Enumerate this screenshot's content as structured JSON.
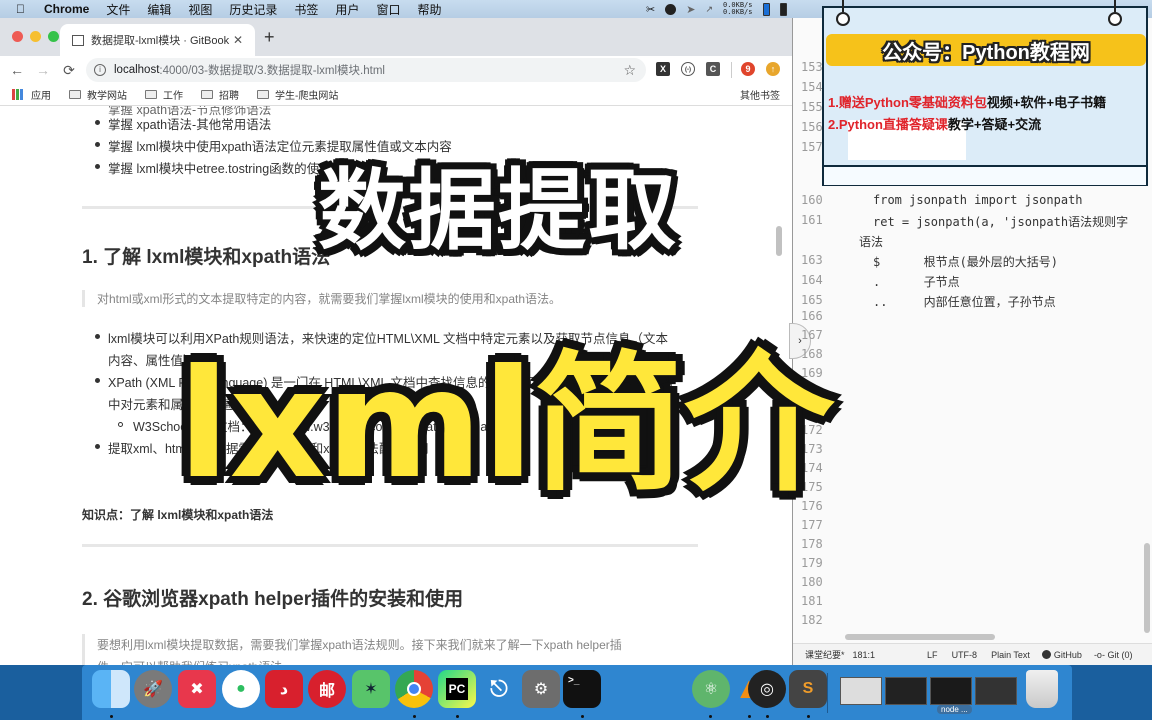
{
  "menubar": {
    "app_name": "Chrome",
    "items": [
      "文件",
      "编辑",
      "视图",
      "历史记录",
      "书签",
      "用户",
      "窗口",
      "帮助"
    ],
    "net_up": "0.0KB/s",
    "net_down": "0.0KB/s"
  },
  "browser": {
    "tab_title": "数据提取-lxml模块 · GitBook",
    "url_host": "localhost",
    "url_path": ":4000/03-数据提取/3.数据提取-lxml模块.html",
    "extensions": [
      "X",
      "(-)",
      "C",
      "9",
      "↑"
    ],
    "bookmarks": [
      "应用",
      "教学网站",
      "工作",
      "招聘",
      "学生-爬虫网站"
    ],
    "other_bookmarks": "其他书签"
  },
  "page": {
    "top_partial": "掌握 xpath语法-节点修饰语法",
    "goals": [
      "掌握 xpath语法-其他常用语法",
      "掌握 lxml模块中使用xpath语法定位元素提取属性值或文本内容",
      "掌握 lxml模块中etree.tostring函数的使用"
    ],
    "section1": {
      "heading": "1. 了解 lxml模块和xpath语法",
      "quote": "对html或xml形式的文本提取特定的内容，就需要我们掌握lxml模块的使用和xpath语法。",
      "bullets": [
        "lxml模块可以利用XPath规则语法，来快速的定位HTML\\XML 文档中特定元素以及获取节点信息（文本",
        "内容、属性值）",
        "XPath (XML Path Language) 是一门在 HTML\\XML 文档中查找信息的语言，可用来在 HTML\\XML 文档",
        "中对元素和属性进行遍历。",
        "提取xml、html中的数据需要lxml模块和xpath语法配合使用"
      ],
      "sub_bullet": "W3School官方文档：http://www.w3school.com.cn/xpath/index.asp",
      "knowledge": "知识点：了解 lxml模块和xpath语法"
    },
    "section2": {
      "heading": "2. 谷歌浏览器xpath helper插件的安装和使用",
      "quote_line1": "要想利用lxml模块提取数据，需要我们掌握xpath语法规则。接下来我们就来了解一下xpath helper插",
      "quote_line2": "件，它可以帮助我们练习xpath语法"
    }
  },
  "editor": {
    "line_numbers_top": [
      "153",
      "154",
      "155",
      "156",
      "157"
    ],
    "lines": [
      {
        "num": "160",
        "text": "from jsonpath import jsonpath"
      },
      {
        "num": "161",
        "text": "ret = jsonpath(a, 'jsonpath语法规则字"
      },
      {
        "num": "",
        "text": "语法"
      },
      {
        "num": "163",
        "text": "$      根节点(最外层的大括号)"
      },
      {
        "num": "164",
        "text": ".      子节点"
      },
      {
        "num": "165",
        "text": "..     内部任意位置，子孙节点"
      }
    ],
    "line_numbers_bottom": [
      "166",
      "167",
      "168",
      "169",
      "170",
      "171",
      "172",
      "173",
      "174",
      "175",
      "176",
      "177",
      "178",
      "179",
      "180",
      "181",
      "182"
    ],
    "status": {
      "file": "课堂纪要*",
      "cursor": "181:1",
      "line_ending": "LF",
      "encoding": "UTF-8",
      "grammar": "Plain Text",
      "github": "GitHub",
      "git": "Git (0)"
    }
  },
  "promo": {
    "header": "公众号：Python教程网",
    "line1_red": "1.赠送Python零基础资料包",
    "line1_black": "视频+软件+电子书籍",
    "line2_red": "2.Python直播答疑课",
    "line2_black": "教学+答疑+交流"
  },
  "overlay": {
    "title_top": "数据提取",
    "title_bottom": "lxml简介"
  },
  "dock": {
    "apps": [
      "Finder",
      "Launchpad",
      "XMind",
      "Evernote",
      "NetEase Music",
      "Mail",
      "MindNode",
      "Chrome",
      "PyCharm",
      "Keynote",
      "System Preferences",
      "Terminal",
      "Atom",
      "VLC",
      "OBS",
      "Sublime Text"
    ],
    "window_label": "node ..."
  }
}
